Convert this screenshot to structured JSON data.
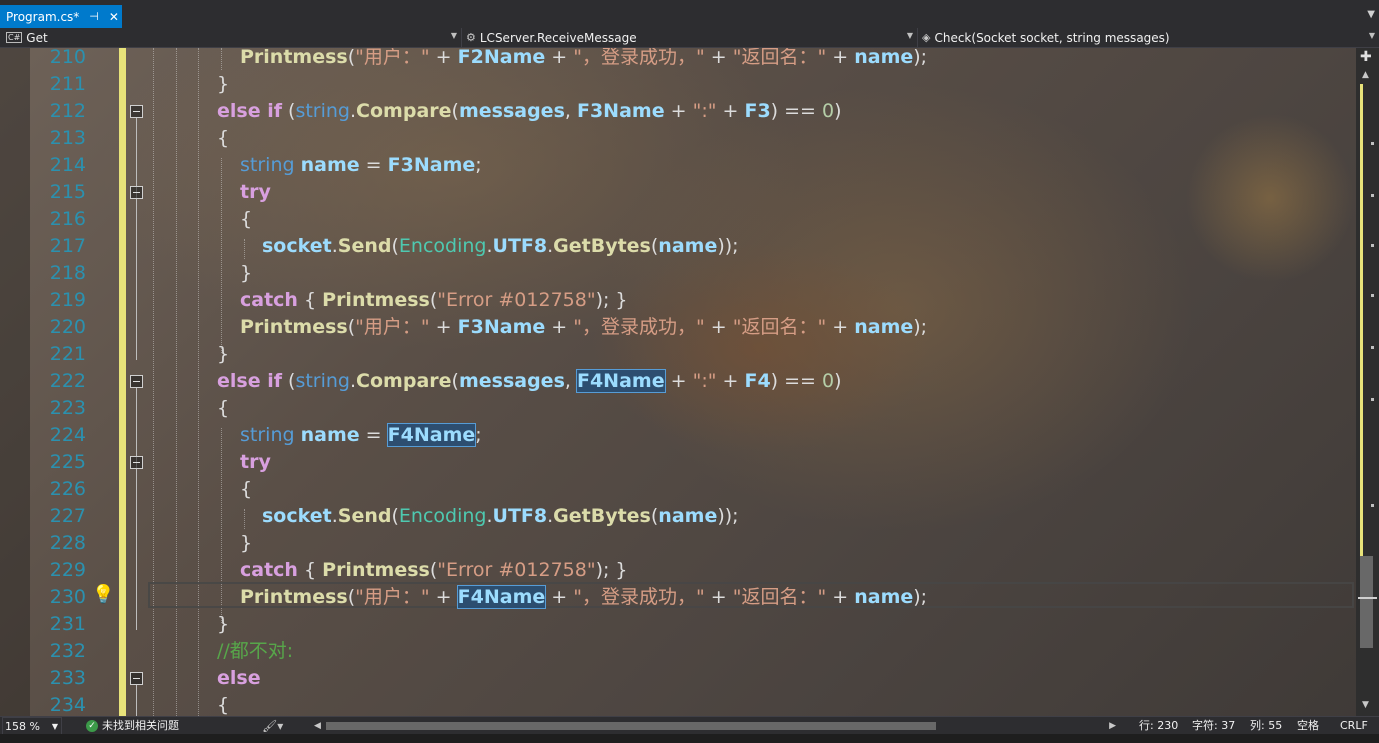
{
  "tab": {
    "title": "Program.cs*",
    "pin_icon": "pin-icon",
    "close_icon": "close-icon"
  },
  "navbar": {
    "project": {
      "label": "Get",
      "icon": "csharp-project-icon"
    },
    "type": {
      "label": "LCServer.ReceiveMessage",
      "icon": "class-icon"
    },
    "member": {
      "label": "Check(Socket socket, string messages)",
      "icon": "method-icon"
    }
  },
  "editor": {
    "lines": [
      {
        "number": "210",
        "text": "Printmess(\"用户：\" + F2Name + \"，登录成功，\" + \"返回名：\" + name);"
      },
      {
        "number": "211",
        "text": "}"
      },
      {
        "number": "212",
        "text": "else if (string.Compare(messages, F3Name + \":\" + F3) == 0)"
      },
      {
        "number": "213",
        "text": "{"
      },
      {
        "number": "214",
        "text": "string name = F3Name;"
      },
      {
        "number": "215",
        "text": "try"
      },
      {
        "number": "216",
        "text": "{"
      },
      {
        "number": "217",
        "text": "socket.Send(Encoding.UTF8.GetBytes(name));"
      },
      {
        "number": "218",
        "text": "}"
      },
      {
        "number": "219",
        "text": "catch { Printmess(\"Error #012758\"); }"
      },
      {
        "number": "220",
        "text": "Printmess(\"用户：\" + F3Name + \"，登录成功，\" + \"返回名：\" + name);"
      },
      {
        "number": "221",
        "text": "}"
      },
      {
        "number": "222",
        "text": "else if (string.Compare(messages, F4Name + \":\" + F4) == 0)"
      },
      {
        "number": "223",
        "text": "{"
      },
      {
        "number": "224",
        "text": "string name = F4Name;"
      },
      {
        "number": "225",
        "text": "try"
      },
      {
        "number": "226",
        "text": "{"
      },
      {
        "number": "227",
        "text": "socket.Send(Encoding.UTF8.GetBytes(name));"
      },
      {
        "number": "228",
        "text": "}"
      },
      {
        "number": "229",
        "text": "catch { Printmess(\"Error #012758\"); }"
      },
      {
        "number": "230",
        "text": "Printmess(\"用户：\" + F4Name + \"，登录成功，\" + \"返回名：\" + name);"
      },
      {
        "number": "231",
        "text": "}"
      },
      {
        "number": "232",
        "text": "//都不对:"
      },
      {
        "number": "233",
        "text": "else"
      },
      {
        "number": "234",
        "text": "{"
      }
    ],
    "highlighted_symbol": "F4Name",
    "current_line": "230",
    "lightbulb_icon": "lightbulb-icon"
  },
  "statusbar": {
    "zoom": "158 %",
    "issues": "未找到相关问题",
    "issues_icon": "check-circle-icon",
    "cleanup_icon": "brush-icon",
    "line": "行: 230",
    "char": "字符: 37",
    "col": "列: 55",
    "whitespace": "空格",
    "line_ending": "CRLF"
  },
  "colors": {
    "accent": "#007acc",
    "change_margin": "#e8e37a",
    "line_number": "#2b91af",
    "keyword": "#d8a0df",
    "type_keyword": "#569cd6",
    "identifier": "#9cdcfe",
    "method": "#dcdcaa",
    "type": "#4ec9b0",
    "string": "#d69d85",
    "number": "#b5cea8",
    "comment": "#57a64a"
  }
}
